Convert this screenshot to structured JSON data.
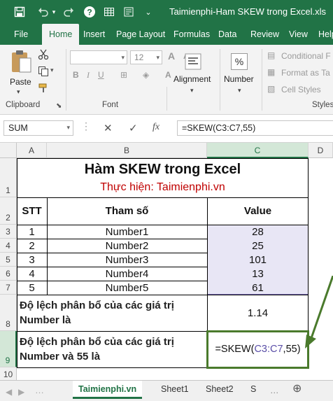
{
  "window": {
    "title": "Taimienphi-Ham SKEW trong Excel.xls",
    "quick_access": [
      "save-icon",
      "undo-icon",
      "redo-icon",
      "help-icon",
      "table-icon",
      "form-icon",
      "dropdown-icon"
    ]
  },
  "ribbon_tabs": [
    {
      "label": "File"
    },
    {
      "label": "Home"
    },
    {
      "label": "Insert"
    },
    {
      "label": "Page Layout"
    },
    {
      "label": "Formulas"
    },
    {
      "label": "Data"
    },
    {
      "label": "Review"
    },
    {
      "label": "View"
    },
    {
      "label": "Help"
    }
  ],
  "ribbon": {
    "paste_label": "Paste",
    "clipboard_label": "Clipboard",
    "font_label": "Font",
    "font_size": "12",
    "alignment_label": "Alignment",
    "number_label": "Number",
    "percent_symbol": "%",
    "conditional_formatting": "Conditional F",
    "format_as_table": "Format as Ta",
    "cell_styles": "Cell Styles",
    "styles_label": "Styles"
  },
  "formula_bar": {
    "name_box": "SUM",
    "fx": "fx",
    "formula": "=SKEW(C3:C7,55)"
  },
  "columns": [
    "A",
    "B",
    "C",
    "D"
  ],
  "rows": [
    "1",
    "2",
    "3",
    "4",
    "5",
    "6",
    "7",
    "8",
    "9",
    "10"
  ],
  "sheet": {
    "title": "Hàm SKEW trong Excel",
    "subtitle": "Thực hiện: Taimienphi.vn",
    "headers": {
      "stt": "STT",
      "param": "Tham số",
      "value": "Value"
    },
    "data_rows": [
      {
        "stt": "1",
        "param": "Number1",
        "value": "28"
      },
      {
        "stt": "2",
        "param": "Number2",
        "value": "25"
      },
      {
        "stt": "3",
        "param": "Number3",
        "value": "101"
      },
      {
        "stt": "4",
        "param": "Number4",
        "value": "13"
      },
      {
        "stt": "5",
        "param": "Number5",
        "value": "61"
      }
    ],
    "result1_label_line1": "Độ lệch phân bổ của các giá trị",
    "result1_label_line2": "Number là",
    "result1_value": "1.14",
    "result2_label_line1": "Độ lệch phân bổ của các giá trị",
    "result2_label_line2": "Number và 55 là",
    "result2_formula_prefix": "=SKEW(",
    "result2_formula_ref": "C3:C7",
    "result2_formula_suffix": ",55)"
  },
  "sheet_tabs": [
    {
      "label": "Taimienphi.vn"
    },
    {
      "label": "Sheet1"
    },
    {
      "label": "Sheet2"
    },
    {
      "label": "S"
    }
  ],
  "colors": {
    "excel_green": "#217346",
    "title_red": "#c00000",
    "range_highlight": "#e8e6f5",
    "range_border": "#7b6fb8",
    "arrow_green": "#4a7a2c"
  }
}
